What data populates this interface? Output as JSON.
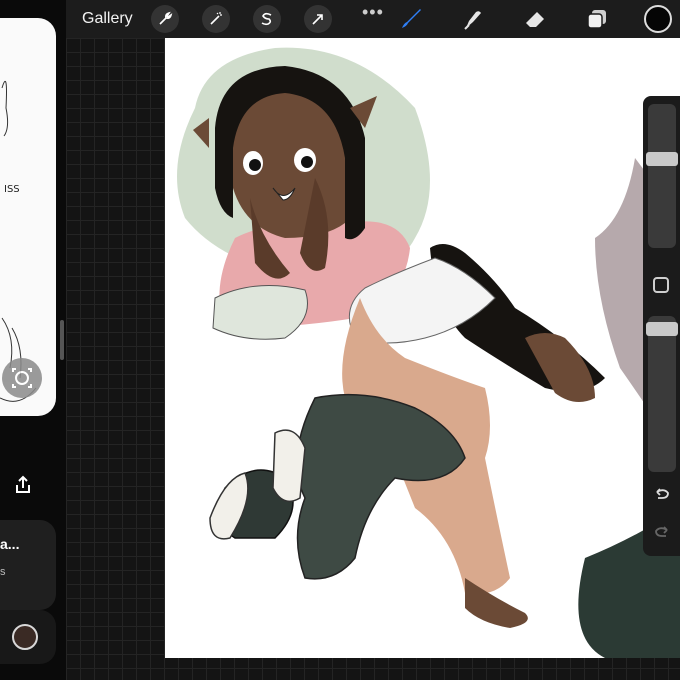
{
  "toolbar": {
    "gallery_label": "Gallery",
    "more_glyph": "•••",
    "left_tools": [
      "wrench-icon",
      "magic-wand-icon",
      "selection-s-icon",
      "transform-arrow-icon"
    ],
    "right_tools": [
      "brush-icon",
      "smudge-icon",
      "eraser-icon",
      "layers-icon"
    ],
    "active_tool": "brush-icon",
    "accent_color": "#2f7ff6",
    "current_color": "#050505"
  },
  "left_panel": {
    "sketch_text": "ISS",
    "card_title": "a...",
    "card_subtitle": "s"
  },
  "sidebar": {
    "brush_size_level": 0.25,
    "opacity_level": 0.08,
    "modify_label": "modify-square-icon",
    "undo_icon": "undo-icon",
    "redo_icon": "redo-icon"
  },
  "canvas": {
    "background": "#ffffff",
    "skin_color": "#6b4a36",
    "hair_color": "#161310",
    "pants_color": "#3e4a44",
    "shirt_color": "#e8a9ab",
    "bg_wash_color": "#b9cdb3"
  }
}
